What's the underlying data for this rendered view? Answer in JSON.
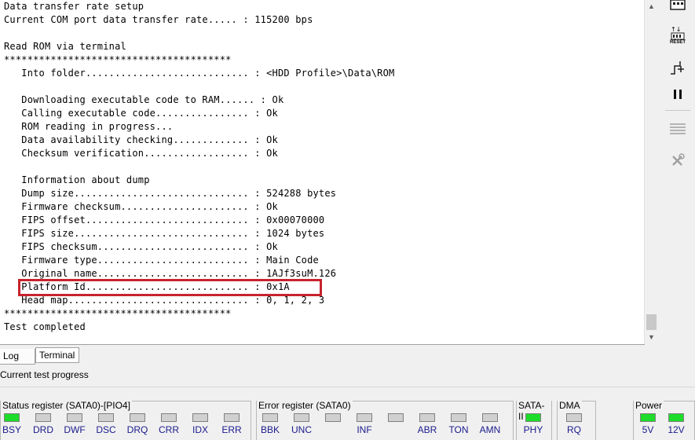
{
  "terminal": {
    "lines": [
      "Data transfer rate setup",
      "Current COM port data transfer rate..... : 115200 bps",
      "",
      "Read ROM via terminal",
      "***************************************",
      "   Into folder............................ : <HDD Profile>\\Data\\ROM",
      "",
      "   Downloading executable code to RAM...... : Ok",
      "   Calling executable code................ : Ok",
      "   ROM reading in progress...",
      "   Data availability checking............. : Ok",
      "   Checksum verification.................. : Ok",
      "",
      "   Information about dump",
      "   Dump size.............................. : 524288 bytes",
      "   Firmware checksum...................... : Ok",
      "   FIPS offset............................ : 0x00070000",
      "   FIPS size.............................. : 1024 bytes",
      "   FIPS checksum.......................... : Ok",
      "   Firmware type.......................... : Main Code",
      "   Original name.......................... : 1AJf3suM.126",
      "   Platform Id............................ : 0x1A",
      "   Head map............................... : 0, 1, 2, 3",
      "***************************************",
      "Test completed"
    ]
  },
  "scrollbar": {
    "up_icon": "scroll-up-arrow",
    "down_icon": "scroll-down-arrow"
  },
  "toolbar": {
    "reset_label": "RESET"
  },
  "tabs": {
    "log": "Log",
    "terminal": "Terminal"
  },
  "progress": {
    "label": "Current test progress"
  },
  "status_register": {
    "title": "Status register (SATA0)-[PIO4]",
    "leds": [
      {
        "label": "BSY",
        "on": true
      },
      {
        "label": "DRD",
        "on": false
      },
      {
        "label": "DWF",
        "on": false
      },
      {
        "label": "DSC",
        "on": false
      },
      {
        "label": "DRQ",
        "on": false
      },
      {
        "label": "CRR",
        "on": false
      },
      {
        "label": "IDX",
        "on": false
      },
      {
        "label": "ERR",
        "on": false
      }
    ]
  },
  "error_register": {
    "title": "Error register (SATA0)",
    "leds": [
      {
        "label": "BBK",
        "on": false
      },
      {
        "label": "UNC",
        "on": false
      },
      {
        "label": "",
        "on": false
      },
      {
        "label": "INF",
        "on": false
      },
      {
        "label": "",
        "on": false
      },
      {
        "label": "ABR",
        "on": false
      },
      {
        "label": "TON",
        "on": false
      },
      {
        "label": "AMN",
        "on": false
      }
    ]
  },
  "sata": {
    "title": "SATA-II",
    "leds": [
      {
        "label": "PHY",
        "on": true
      }
    ]
  },
  "dma": {
    "title": "DMA",
    "leds": [
      {
        "label": "RQ",
        "on": false
      }
    ]
  },
  "power": {
    "title": "Power",
    "leds": [
      {
        "label": "5V",
        "on": true
      },
      {
        "label": "12V",
        "on": true
      }
    ]
  },
  "colors": {
    "led_on": "#1ddc2a",
    "led_off": "#d0d0d0",
    "highlight": "#c8232c",
    "led_label": "#1a1a8c"
  }
}
